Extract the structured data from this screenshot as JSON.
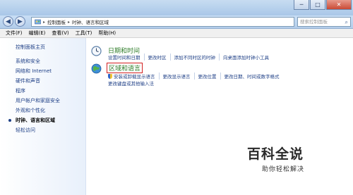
{
  "window": {
    "title_bar_color": "#b6cfea",
    "buttons": {
      "minimize": "─",
      "maximize": "□",
      "close": "✕"
    }
  },
  "nav": {
    "back_glyph": "◀",
    "forward_glyph": "▶",
    "breadcrumb": [
      "控制面板",
      "时钟、语言和区域"
    ],
    "search_placeholder": "搜索控制面板"
  },
  "menu": [
    "文件(F)",
    "编辑(E)",
    "查看(V)",
    "工具(T)",
    "帮助(H)"
  ],
  "sidebar": {
    "home": "控制面板主页",
    "items": [
      {
        "label": "系统和安全",
        "current": false
      },
      {
        "label": "网络和 Internet",
        "current": false
      },
      {
        "label": "硬件和声音",
        "current": false
      },
      {
        "label": "程序",
        "current": false
      },
      {
        "label": "用户帐户和家庭安全",
        "current": false
      },
      {
        "label": "外观和个性化",
        "current": false
      },
      {
        "label": "时钟、语言和区域",
        "current": true
      },
      {
        "label": "轻松访问",
        "current": false
      }
    ]
  },
  "groups": [
    {
      "title": "日期和时间",
      "icon": "clock-icon",
      "links": [
        "设置时间和日期",
        "更改时区",
        "添加不同时区的时钟",
        "向桌面添加时钟小工具"
      ]
    },
    {
      "title": "区域和语言",
      "icon": "globe-icon",
      "highlight_color": "#d11f1f",
      "links_row1": [
        "安装或卸载显示语言",
        "更改显示语言",
        "更改位置",
        "更改日期、时间或数字格式"
      ],
      "links_row2": [
        "更改键盘或其他输入法"
      ]
    }
  ],
  "watermark": {
    "main": "百科全说",
    "sub": "助你轻松解决"
  }
}
